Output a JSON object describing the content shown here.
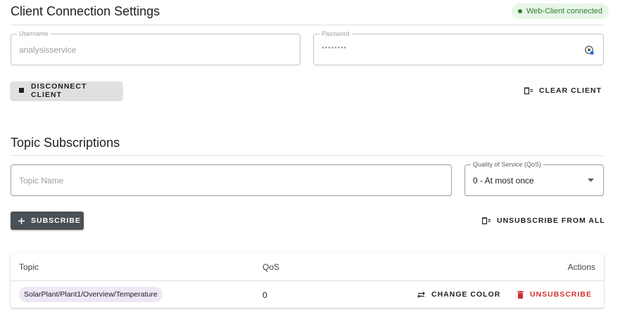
{
  "client_section": {
    "title": "Client Connection Settings",
    "status": "Web-Client connected",
    "username": {
      "label": "Username",
      "value": "analysisservice"
    },
    "password": {
      "label": "Password",
      "value": "••••••••"
    },
    "disconnect_label": "DISCONNECT CLIENT",
    "clear_label": "CLEAR CLIENT"
  },
  "topics_section": {
    "title": "Topic Subscriptions",
    "topic_placeholder": "Topic Name",
    "qos_label": "Quality of Service (QoS)",
    "qos_selected": "0 - At most once",
    "subscribe_label": "SUBSCRIBE",
    "unsubscribe_all_label": "UNSUBSCRIBE FROM ALL"
  },
  "table": {
    "headers": {
      "topic": "Topic",
      "qos": "QoS",
      "actions": "Actions"
    },
    "rows": [
      {
        "topic": "SolarPlant/Plant1/Overview/Temperature",
        "qos": "0",
        "change_color_label": "CHANGE COLOR",
        "unsubscribe_label": "UNSUBSCRIBE"
      }
    ]
  },
  "colors": {
    "status_green": "#2e7d32",
    "status_bg": "#e8f5e9",
    "danger": "#d32f2f",
    "chip_bg": "#ede7f6",
    "dark_button": "#4a5156"
  },
  "icons": [
    "stop-icon",
    "clear-list-icon",
    "plus-icon",
    "swap-arrows-icon",
    "trash-icon",
    "password-manager-icon",
    "dropdown-arrow-icon"
  ]
}
